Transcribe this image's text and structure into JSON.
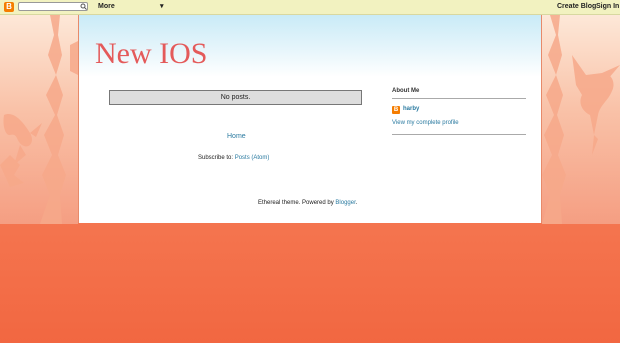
{
  "navbar": {
    "logo_glyph": "B",
    "search_placeholder": "",
    "more_label": "More",
    "create_blog_label": "Create Blog",
    "sign_in_label": "Sign In"
  },
  "blog": {
    "title": "New IOS"
  },
  "main": {
    "status_message": "No posts.",
    "home_link": "Home",
    "subscribe_prefix": "Subscribe to:",
    "subscribe_link": "Posts (Atom)"
  },
  "sidebar": {
    "about_title": "About Me",
    "profile_name": "harby",
    "profile_link": "View my complete profile"
  },
  "footer": {
    "text_prefix": "Ethereal theme. Powered by",
    "link": "Blogger",
    "text_suffix": "."
  },
  "colors": {
    "title": "#e45a5a",
    "link": "#2a7aa0",
    "navbar_bg": "#f2f2c0",
    "blogger_orange": "#f57d00"
  }
}
